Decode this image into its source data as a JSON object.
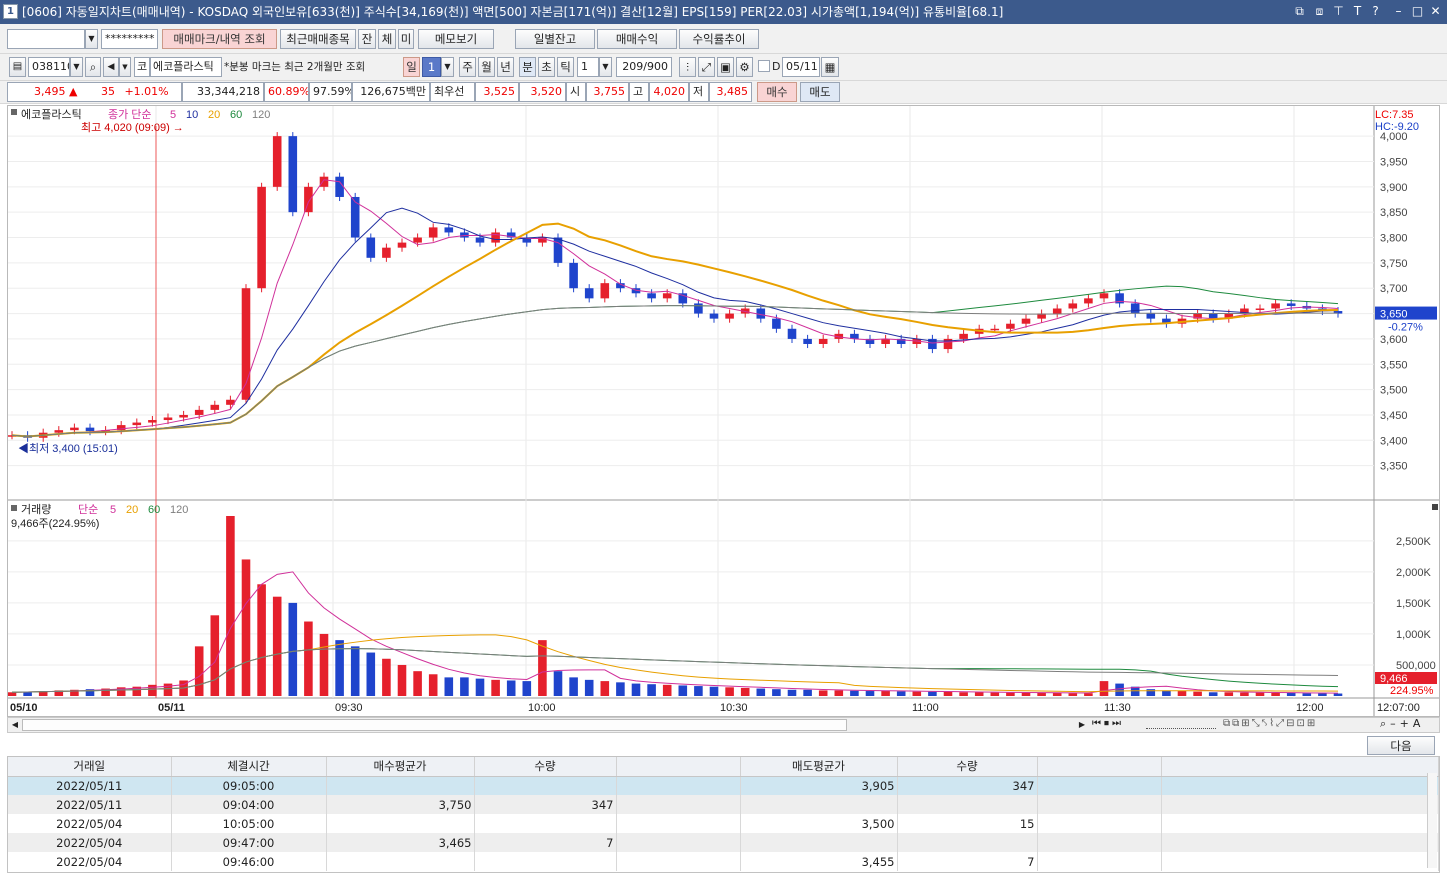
{
  "title": {
    "num": "1",
    "text": "[0606] 자동일지차트(매매내역) - KOSDAQ 외국인보유[633(천)] 주식수[34,169(천)] 액면[500] 자본금[171(억)] 결산[12월] EPS[159] PER[22.03] 시가총액[1,194(억)] 유통비율[68.1]"
  },
  "toolbar1": {
    "account": "",
    "password": "*********",
    "btn_query": "매매마크/내역 조회",
    "btn_recent": "최근매매종목",
    "btn_jan": "잔",
    "btn_che": "체",
    "btn_mi": "미",
    "btn_memo": "메모보기",
    "btn_daily": "일별잔고",
    "btn_profit": "매매수익",
    "btn_return": "수익률추이"
  },
  "toolbar2": {
    "code": "038110",
    "market": "코",
    "name": "에코플라스틱",
    "note": "*분봉 마크는 최근 2개월만 조회",
    "period_day": "일",
    "period_num": "1",
    "p_week": "주",
    "p_month": "월",
    "p_year": "년",
    "p_min": "분",
    "p_sec": "초",
    "p_tick": "틱",
    "interval": "1",
    "count": "209/900",
    "d_label": "D",
    "date": "05/11"
  },
  "quote": {
    "price": "3,495",
    "arrow": "▲",
    "change": "35",
    "rate": "+1.01%",
    "volume": "33,344,218",
    "r1": "60.89%",
    "r2": "97.59%",
    "amount": "126,675백만",
    "best_label": "최우선",
    "ask": "3,525",
    "bid": "3,520",
    "open_label": "시",
    "open": "3,755",
    "high_label": "고",
    "high": "4,020",
    "low_label": "저",
    "low": "3,485",
    "buy": "매수",
    "sell": "매도"
  },
  "chart_data": {
    "type": "candlestick",
    "price_title": "에코플라스틱",
    "price_legend": [
      "종가 단순",
      "5",
      "10",
      "20",
      "60",
      "120"
    ],
    "volume_title": "거래량",
    "volume_legend": [
      "단순",
      "5",
      "20",
      "60",
      "120"
    ],
    "volume_info": "9,466주(224.95%)",
    "high_mark": "최고 4,020 (09:09)",
    "low_mark": "최저 3,400 (15:01)",
    "lc": "LC:7.35",
    "hc": "HC:-9.20",
    "last_price": "3,650",
    "last_rate": "-0.27%",
    "last_volume": "9,466",
    "last_vol_rate": "224.95%",
    "ylim": [
      3300,
      4020
    ],
    "y_ticks": [
      "4,000",
      "3,950",
      "3,900",
      "3,850",
      "3,800",
      "3,750",
      "3,700",
      "3,650",
      "3,600",
      "3,550",
      "3,500",
      "3,450",
      "3,400",
      "3,350"
    ],
    "vol_ticks": [
      "2,500K",
      "2,000K",
      "1,500K",
      "1,000K",
      "500,000"
    ],
    "x_labels": [
      "05/10",
      "05/11",
      "09:30",
      "10:00",
      "10:30",
      "11:00",
      "11:30",
      "12:00",
      "12:07:00"
    ],
    "close": [
      3410,
      3405,
      3415,
      3420,
      3425,
      3418,
      3420,
      3430,
      3435,
      3440,
      3445,
      3450,
      3460,
      3470,
      3480,
      3700,
      3900,
      4000,
      3850,
      3900,
      3920,
      3880,
      3800,
      3760,
      3780,
      3790,
      3800,
      3820,
      3810,
      3800,
      3790,
      3810,
      3800,
      3790,
      3800,
      3750,
      3700,
      3680,
      3710,
      3700,
      3690,
      3680,
      3690,
      3670,
      3650,
      3640,
      3650,
      3660,
      3640,
      3620,
      3600,
      3590,
      3600,
      3610,
      3600,
      3590,
      3600,
      3590,
      3600,
      3580,
      3600,
      3610,
      3620,
      3620,
      3630,
      3640,
      3650,
      3660,
      3670,
      3680,
      3690,
      3670,
      3650,
      3640,
      3630,
      3640,
      3650,
      3640,
      3650,
      3660,
      3660,
      3670,
      3665,
      3660,
      3655,
      3650
    ],
    "volume": [
      60,
      70,
      80,
      90,
      100,
      110,
      120,
      140,
      150,
      180,
      200,
      250,
      800,
      1300,
      2900,
      2200,
      1800,
      1600,
      1500,
      1200,
      1000,
      900,
      800,
      700,
      600,
      500,
      400,
      350,
      300,
      300,
      280,
      260,
      250,
      240,
      900,
      400,
      300,
      260,
      240,
      220,
      200,
      190,
      180,
      170,
      160,
      150,
      140,
      130,
      120,
      110,
      100,
      100,
      90,
      90,
      85,
      80,
      80,
      75,
      70,
      70,
      65,
      60,
      60,
      55,
      55,
      50,
      50,
      50,
      45,
      45,
      240,
      200,
      150,
      110,
      90,
      80,
      70,
      60,
      60,
      55,
      55,
      50,
      50,
      45,
      45,
      40
    ]
  },
  "grid": {
    "headers": [
      "거래일",
      "체결시간",
      "매수평균가",
      "수량",
      "",
      "매도평균가",
      "수량",
      "",
      ""
    ],
    "rows": [
      [
        "2022/05/11",
        "09:05:00",
        "",
        "",
        "",
        "3,905",
        "347",
        "",
        ""
      ],
      [
        "2022/05/11",
        "09:04:00",
        "3,750",
        "347",
        "",
        "",
        "",
        "",
        ""
      ],
      [
        "2022/05/04",
        "10:05:00",
        "",
        "",
        "",
        "3,500",
        "15",
        "",
        ""
      ],
      [
        "2022/05/04",
        "09:47:00",
        "3,465",
        "7",
        "",
        "",
        "",
        "",
        ""
      ],
      [
        "2022/05/04",
        "09:46:00",
        "",
        "",
        "",
        "3,455",
        "7",
        "",
        ""
      ]
    ],
    "next": "다음"
  },
  "colors": {
    "up": "#e5202c",
    "down": "#1f44cc",
    "ma5": "#d0309a",
    "ma10": "#1f2fa0",
    "ma20": "#e8a000",
    "ma60": "#1e8a3e",
    "ma120": "#7e7e7e"
  }
}
